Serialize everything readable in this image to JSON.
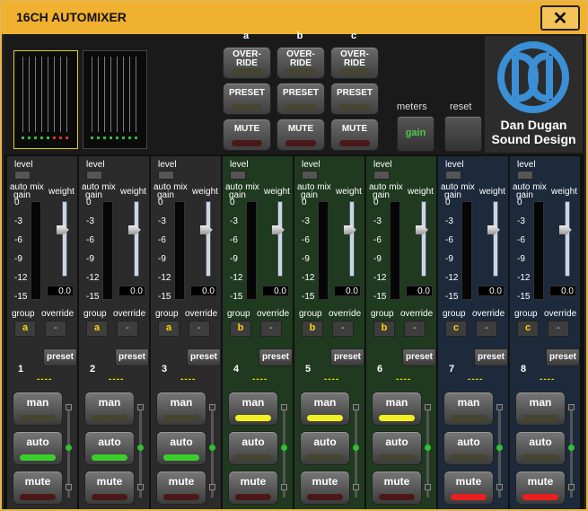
{
  "window": {
    "title": "16CH AUTOMIXER",
    "close_label": "✕",
    "accent": "#f0b030"
  },
  "groups": {
    "headers": [
      "a",
      "b",
      "c"
    ],
    "override_label": "OVER-\nRIDE",
    "preset_label": "PRESET",
    "mute_label": "MUTE"
  },
  "meters": {
    "label": "meters",
    "button_label": "gain"
  },
  "reset": {
    "label": "reset"
  },
  "logo": {
    "line1": "Dan Dugan",
    "line2": "Sound Design",
    "icon": "dan-dugan-logo"
  },
  "strip_labels": {
    "level": "level",
    "automix": "auto mix",
    "gain": "gain",
    "weight": "weight",
    "group": "group",
    "override": "override",
    "preset": "preset",
    "man": "man",
    "auto": "auto",
    "mute": "mute"
  },
  "scale_ticks": [
    "0",
    "-3",
    "-6",
    "-9",
    "-12",
    "-15"
  ],
  "channels": [
    {
      "num": "1",
      "group": "a",
      "override": "-",
      "weight": "0.0",
      "id": "----",
      "bg": "#2b2b2b",
      "man": false,
      "auto": true,
      "mute": false
    },
    {
      "num": "2",
      "group": "a",
      "override": "-",
      "weight": "0.0",
      "id": "----",
      "bg": "#2b2b2b",
      "man": false,
      "auto": true,
      "mute": false
    },
    {
      "num": "3",
      "group": "a",
      "override": "-",
      "weight": "0.0",
      "id": "----",
      "bg": "#2b2b2b",
      "man": false,
      "auto": true,
      "mute": false
    },
    {
      "num": "4",
      "group": "b",
      "override": "-",
      "weight": "0.0",
      "id": "----",
      "bg": "#1f3a1f",
      "man": true,
      "auto": false,
      "mute": false
    },
    {
      "num": "5",
      "group": "b",
      "override": "-",
      "weight": "0.0",
      "id": "----",
      "bg": "#1f3a1f",
      "man": true,
      "auto": false,
      "mute": false
    },
    {
      "num": "6",
      "group": "b",
      "override": "-",
      "weight": "0.0",
      "id": "----",
      "bg": "#1f3a1f",
      "man": true,
      "auto": false,
      "mute": false
    },
    {
      "num": "7",
      "group": "c",
      "override": "-",
      "weight": "0.0",
      "id": "----",
      "bg": "#1c2a3c",
      "man": false,
      "auto": false,
      "mute": true
    },
    {
      "num": "8",
      "group": "c",
      "override": "-",
      "weight": "0.0",
      "id": "----",
      "bg": "#1c2a3c",
      "man": false,
      "auto": false,
      "mute": true
    }
  ],
  "colors": {
    "indicator_off": "#454530",
    "mute_off": "#4a1818",
    "auto_on": "#3ccf2c",
    "man_on": "#f0f020",
    "mute_on": "#e82020",
    "group_text": "#ffd400"
  }
}
